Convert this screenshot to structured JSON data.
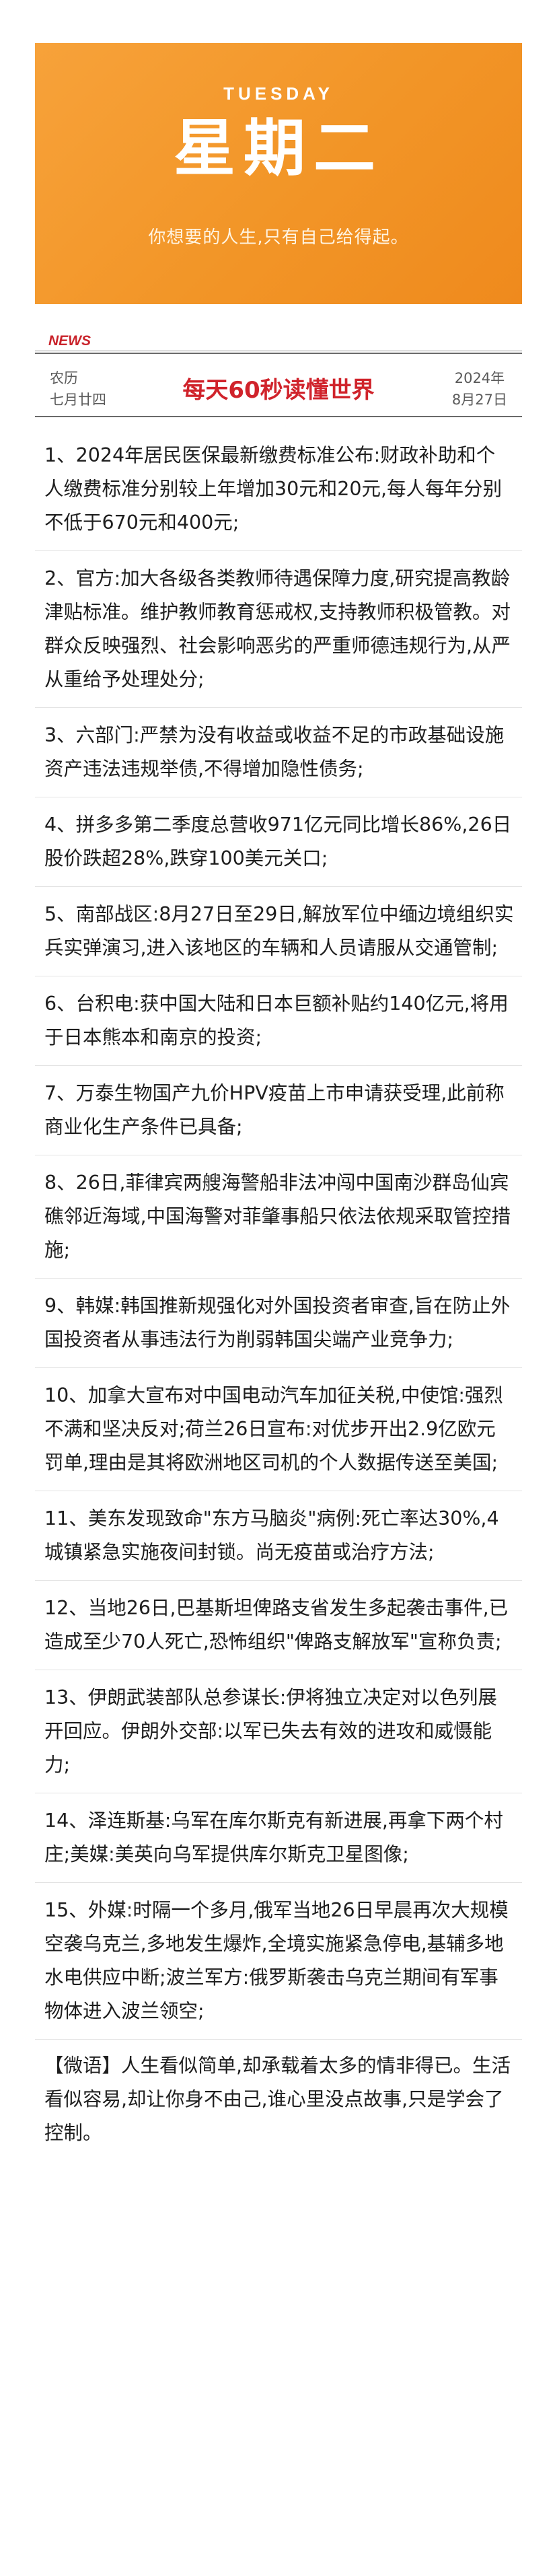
{
  "banner": {
    "weekday_en": "TUESDAY",
    "weekday_cn": "星期二",
    "slogan": "你想要的人生,只有自己给得起。",
    "color": "#f29527"
  },
  "news": {
    "tag": "NEWS",
    "lunar_label": "农历",
    "lunar_date": "七月廿四",
    "headline": "每天60秒读懂世界",
    "year": "2024年",
    "date": "8月27日"
  },
  "items": [
    "1、2024年居民医保最新缴费标准公布:财政补助和个人缴费标准分别较上年增加30元和20元,每人每年分别不低于670元和400元;",
    "2、官方:加大各级各类教师待遇保障力度,研究提高教龄津贴标准。维护教师教育惩戒权,支持教师积极管教。对群众反映强烈、社会影响恶劣的严重师德违规行为,从严从重给予处理处分;",
    "3、六部门:严禁为没有收益或收益不足的市政基础设施资产违法违规举债,不得增加隐性债务;",
    "4、拼多多第二季度总营收971亿元同比增长86%,26日股价跌超28%,跌穿100美元关口;",
    "5、南部战区:8月27日至29日,解放军位中缅边境组织实兵实弹演习,进入该地区的车辆和人员请服从交通管制;",
    "6、台积电:获中国大陆和日本巨额补贴约140亿元,将用于日本熊本和南京的投资;",
    "7、万泰生物国产九价HPV疫苗上市申请获受理,此前称商业化生产条件已具备;",
    "8、26日,菲律宾两艘海警船非法冲闯中国南沙群岛仙宾礁邻近海域,中国海警对菲肇事船只依法依规采取管控措施;",
    "9、韩媒:韩国推新规强化对外国投资者审查,旨在防止外国投资者从事违法行为削弱韩国尖端产业竞争力;",
    "10、加拿大宣布对中国电动汽车加征关税,中使馆:强烈不满和坚决反对;荷兰26日宣布:对优步开出2.9亿欧元罚单,理由是其将欧洲地区司机的个人数据传送至美国;",
    "11、美东发现致命\"东方马脑炎\"病例:死亡率达30%,4城镇紧急实施夜间封锁。尚无疫苗或治疗方法;",
    "12、当地26日,巴基斯坦俾路支省发生多起袭击事件,已造成至少70人死亡,恐怖组织\"俾路支解放军\"宣称负责;",
    "13、伊朗武装部队总参谋长:伊将独立决定对以色列展开回应。伊朗外交部:以军已失去有效的进攻和威慑能力;",
    "14、泽连斯基:乌军在库尔斯克有新进展,再拿下两个村庄;美媒:美英向乌军提供库尔斯克卫星图像;",
    "15、外媒:时隔一个多月,俄军当地26日早晨再次大规模空袭乌克兰,多地发生爆炸,全境实施紧急停电,基辅多地水电供应中断;波兰军方:俄罗斯袭击乌克兰期间有军事物体进入波兰领空;"
  ],
  "quote": "【微语】人生看似简单,却承载着太多的情非得已。生活看似容易,却让你身不由己,谁心里没点故事,只是学会了控制。"
}
